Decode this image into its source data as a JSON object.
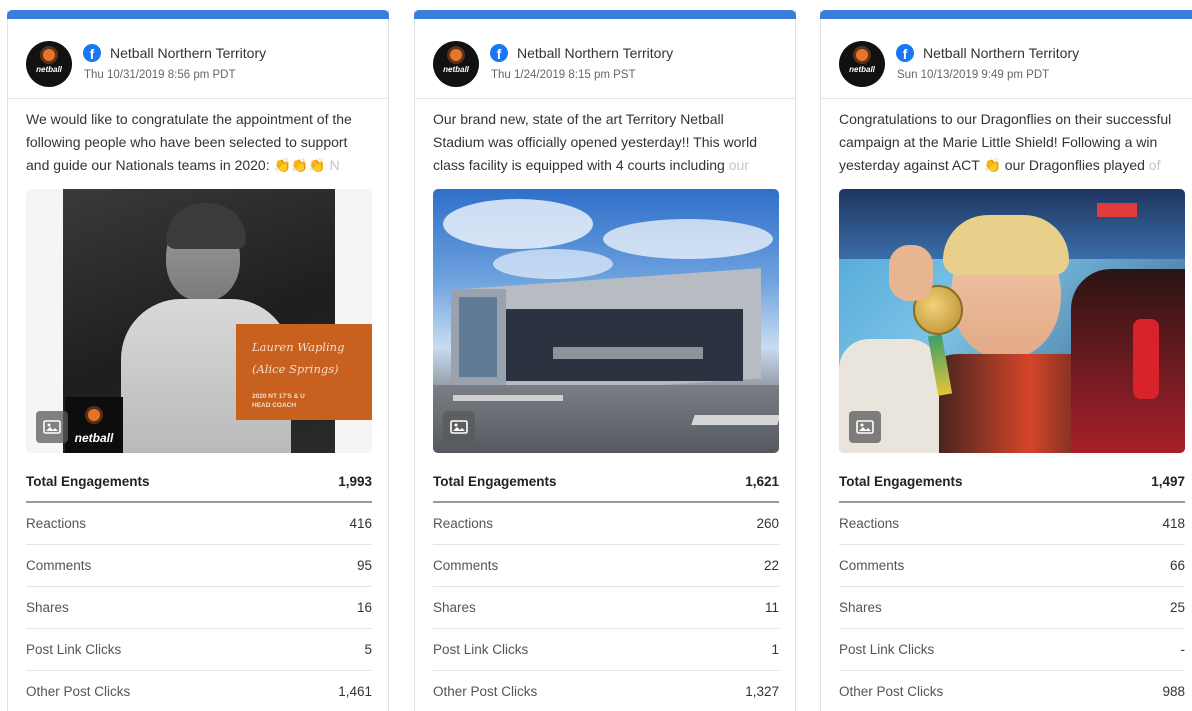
{
  "cards": [
    {
      "page_name": "Netball Northern Territory",
      "date": "Thu 10/31/2019 8:56 pm PDT",
      "text_main": "We would like to congratulate the appointment of the following people who have been selected to support and guide our Nationals teams in 2020: 👏👏👏",
      "text_fade": " N",
      "image_caption": {
        "name": "Lauren Wapling",
        "location": "(Alice Springs)",
        "role_line1": "2020 NT 17'S & U",
        "role_line2": "HEAD COACH",
        "logo": "netball"
      },
      "stats": {
        "total_label": "Total Engagements",
        "total": "1,993",
        "rows": [
          {
            "label": "Reactions",
            "value": "416"
          },
          {
            "label": "Comments",
            "value": "95"
          },
          {
            "label": "Shares",
            "value": "16"
          },
          {
            "label": "Post Link Clicks",
            "value": "5"
          },
          {
            "label": "Other Post Clicks",
            "value": "1,461"
          }
        ]
      }
    },
    {
      "page_name": "Netball Northern Territory",
      "date": "Thu 1/24/2019 8:15 pm PST",
      "text_main": "Our brand new, state of the art Territory Netball Stadium was officially opened yesterday!! This world class facility is equipped with 4 courts including ",
      "text_fade": "our",
      "stats": {
        "total_label": "Total Engagements",
        "total": "1,621",
        "rows": [
          {
            "label": "Reactions",
            "value": "260"
          },
          {
            "label": "Comments",
            "value": "22"
          },
          {
            "label": "Shares",
            "value": "11"
          },
          {
            "label": "Post Link Clicks",
            "value": "1"
          },
          {
            "label": "Other Post Clicks",
            "value": "1,327"
          }
        ]
      }
    },
    {
      "page_name": "Netball Northern Territory",
      "date": "Sun 10/13/2019 9:49 pm PDT",
      "text_main": "Congratulations to our Dragonflies on their successful campaign at the Marie Little Shield! Following a win yesterday against ACT 👏 our Dragonflies played ",
      "text_fade": "of",
      "stats": {
        "total_label": "Total Engagements",
        "total": "1,497",
        "rows": [
          {
            "label": "Reactions",
            "value": "418"
          },
          {
            "label": "Comments",
            "value": "66"
          },
          {
            "label": "Shares",
            "value": "25"
          },
          {
            "label": "Post Link Clicks",
            "value": "-"
          },
          {
            "label": "Other Post Clicks",
            "value": "988"
          }
        ]
      }
    }
  ],
  "colors": {
    "accent_bar": "#3b7ddd",
    "facebook": "#1877f2",
    "caption_orange": "#c8611f"
  }
}
